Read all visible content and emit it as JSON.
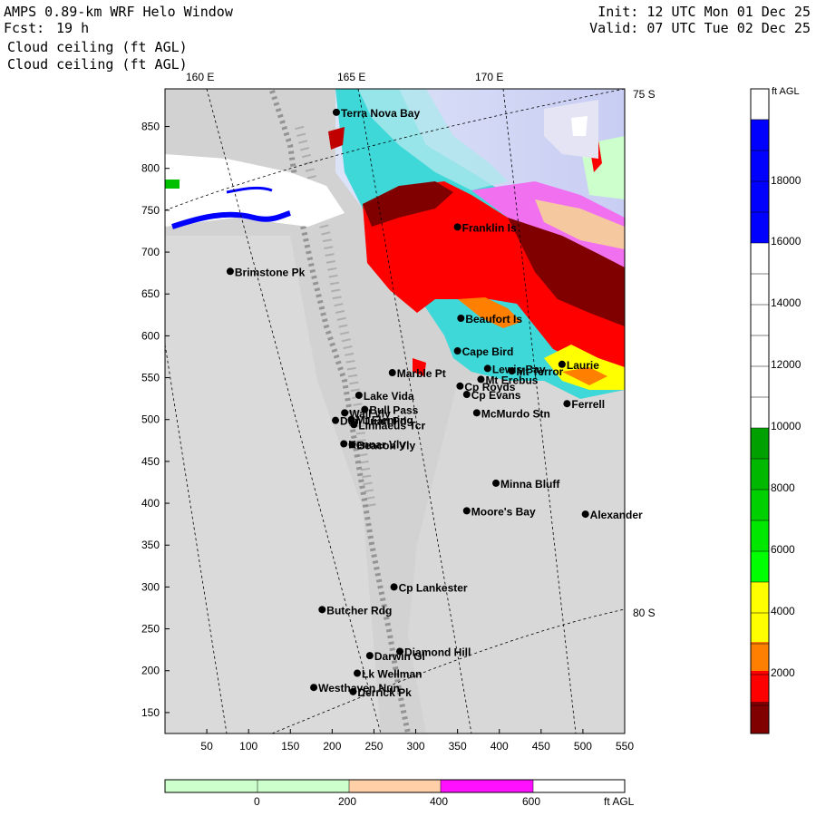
{
  "header": {
    "model_title": "AMPS 0.89-km WRF Helo Window",
    "forecast_label": "Fcst:",
    "forecast_hour": "19 h",
    "field_line_1": "Cloud ceiling (ft AGL)",
    "field_line_2": "Cloud ceiling (ft AGL)",
    "init_line": "Init: 12 UTC Mon 01 Dec 25",
    "valid_line": "Valid: 07 UTC Tue 02 Dec 25"
  },
  "map": {
    "lon_labels": [
      "160 E",
      "165 E",
      "170 E"
    ],
    "lat_labels": [
      "75 S",
      "80 S"
    ],
    "x_ticks": [
      "50",
      "100",
      "150",
      "200",
      "250",
      "300",
      "350",
      "400",
      "450",
      "500",
      "550"
    ],
    "y_ticks": [
      "150",
      "200",
      "250",
      "300",
      "350",
      "400",
      "450",
      "500",
      "550",
      "600",
      "650",
      "700",
      "750",
      "800",
      "850"
    ],
    "stations": [
      {
        "name": "Terra Nova Bay",
        "x": 205,
        "y": 867
      },
      {
        "name": "Franklin Is",
        "x": 350,
        "y": 730
      },
      {
        "name": "Brimstone Pk",
        "x": 78,
        "y": 677
      },
      {
        "name": "Beaufort Is",
        "x": 354,
        "y": 621
      },
      {
        "name": "Cape Bird",
        "x": 350,
        "y": 582
      },
      {
        "name": "Lewis Bay",
        "x": 386,
        "y": 561
      },
      {
        "name": "Laurie",
        "x": 475,
        "y": 566
      },
      {
        "name": "Mt Terror",
        "x": 415,
        "y": 558
      },
      {
        "name": "Marble Pt",
        "x": 272,
        "y": 556
      },
      {
        "name": "Cp Royds",
        "x": 353,
        "y": 540
      },
      {
        "name": "Mt Erebus",
        "x": 378,
        "y": 548
      },
      {
        "name": "Lake Vida",
        "x": 232,
        "y": 529
      },
      {
        "name": "Cp Evans",
        "x": 361,
        "y": 530
      },
      {
        "name": "Ferrell",
        "x": 481,
        "y": 519
      },
      {
        "name": "Wall Vly",
        "x": 215,
        "y": 508
      },
      {
        "name": "Bull Pass",
        "x": 239,
        "y": 512
      },
      {
        "name": "McMurdo Stn",
        "x": 373,
        "y": 508
      },
      {
        "name": "Don Juan Pd",
        "x": 204,
        "y": 499
      },
      {
        "name": "Linnaeus Tcr",
        "x": 226,
        "y": 494
      },
      {
        "name": "Mt Fleming",
        "x": 223,
        "y": 500
      },
      {
        "name": "Kennar Vly",
        "x": 214,
        "y": 471
      },
      {
        "name": "Beacon Vly",
        "x": 224,
        "y": 470
      },
      {
        "name": "Minna Bluff",
        "x": 396,
        "y": 424
      },
      {
        "name": "Moore's Bay",
        "x": 361,
        "y": 391
      },
      {
        "name": "Alexander",
        "x": 503,
        "y": 387
      },
      {
        "name": "Cp Lankester",
        "x": 274,
        "y": 300
      },
      {
        "name": "Butcher Rdg",
        "x": 188,
        "y": 273
      },
      {
        "name": "Diamond Hill",
        "x": 281,
        "y": 223
      },
      {
        "name": "Darwin Gl",
        "x": 245,
        "y": 218
      },
      {
        "name": "Lk Wellman",
        "x": 230,
        "y": 197
      },
      {
        "name": "Westhaven Nun",
        "x": 178,
        "y": 180
      },
      {
        "name": "Derrick Pk",
        "x": 225,
        "y": 175
      }
    ]
  },
  "colorbar": {
    "unit_label": "ft AGL",
    "tick_labels": [
      "2000",
      "4000",
      "6000",
      "8000",
      "10000",
      "12000",
      "14000",
      "16000",
      "18000"
    ],
    "colors": {
      "0-1000": "#800000",
      "1000-2000": "#ff0000",
      "2000-3000": "#ff7f00",
      "3000-5000": "#ffff00",
      "5000-10000": "#00c000",
      "10000-16000": "#ffffff",
      "16000-20000": "#0000ff"
    }
  },
  "bottom_bar": {
    "tick_labels": [
      "0",
      "200",
      "400",
      "600"
    ],
    "unit_label": "ft AGL",
    "colors": [
      "#ccffcc",
      "#ccffcc",
      "#ffd0a8",
      "#ff10ff",
      "#ffffff"
    ]
  }
}
